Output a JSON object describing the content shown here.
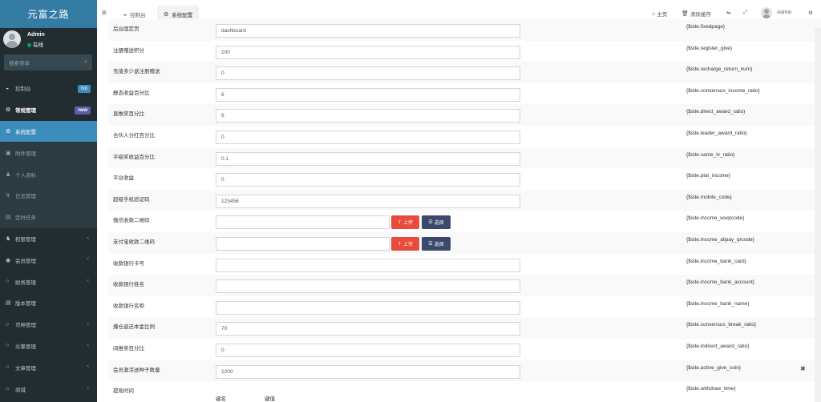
{
  "sidebar": {
    "brand": "元富之路",
    "user": {
      "name": "Admin",
      "status": "在线"
    },
    "search_placeholder": "搜索菜单",
    "items": [
      {
        "icon": "dashboard-icon",
        "glyph": "◒",
        "label": "控制台",
        "badge": "hot",
        "badge_color": "#3c8dbc",
        "style": "normal",
        "chevron": false
      },
      {
        "icon": "cogs-icon",
        "glyph": "⚙",
        "label": "常规管理",
        "badge": "new",
        "badge_color": "#605ca8",
        "style": "strong",
        "chevron": false
      },
      {
        "icon": "cog-icon",
        "glyph": "⚙",
        "label": "系统配置",
        "badge": "",
        "style": "active",
        "chevron": false
      },
      {
        "icon": "file-image-icon",
        "glyph": "▣",
        "label": "附件管理",
        "badge": "",
        "style": "sub",
        "chevron": false
      },
      {
        "icon": "user-icon",
        "glyph": "♟",
        "label": "个人资料",
        "badge": "",
        "style": "sub",
        "chevron": false
      },
      {
        "icon": "log-icon",
        "glyph": "↯",
        "label": "日志管理",
        "badge": "",
        "style": "sub",
        "chevron": false
      },
      {
        "icon": "tasks-icon",
        "glyph": "▤",
        "label": "定时任务",
        "badge": "",
        "style": "sub",
        "chevron": false
      },
      {
        "icon": "group-icon",
        "glyph": "♞",
        "label": "权限管理",
        "badge": "",
        "style": "normal",
        "chevron": true
      },
      {
        "icon": "user-circle-icon",
        "glyph": "◉",
        "label": "会员管理",
        "badge": "",
        "style": "normal",
        "chevron": true
      },
      {
        "icon": "circle-icon",
        "glyph": "○",
        "label": "财务管理",
        "badge": "",
        "style": "normal",
        "chevron": true
      },
      {
        "icon": "list-icon",
        "glyph": "▤",
        "label": "版本管理",
        "badge": "",
        "style": "normal",
        "chevron": false
      },
      {
        "icon": "circle-icon",
        "glyph": "○",
        "label": "币种管理",
        "badge": "",
        "style": "normal",
        "chevron": true
      },
      {
        "icon": "circle-icon",
        "glyph": "○",
        "label": "众筹管理",
        "badge": "",
        "style": "normal",
        "chevron": true
      },
      {
        "icon": "circle-icon",
        "glyph": "○",
        "label": "文章管理",
        "badge": "",
        "style": "normal",
        "chevron": true
      },
      {
        "icon": "home-icon",
        "glyph": "⌂",
        "label": "商城",
        "badge": "",
        "style": "normal",
        "chevron": true
      }
    ]
  },
  "header": {
    "tabs": [
      {
        "label": "控制台",
        "icon": "dashboard-icon",
        "glyph": "◒",
        "active": false
      },
      {
        "label": "系统配置",
        "icon": "cog-icon",
        "glyph": "⚙",
        "active": true
      }
    ],
    "right": {
      "home_label": "主页",
      "clear_cache_label": "清除缓存",
      "user_name": "Admin"
    }
  },
  "config_rows": [
    {
      "label": "后台固定页",
      "value": "dashboard",
      "key": "{$site.fixedpage}",
      "type": "text"
    },
    {
      "label": "注册赠送积分",
      "value": "100",
      "key": "{$site.register_give}",
      "type": "text"
    },
    {
      "label": "充值多少返注册赠送",
      "value": "0",
      "key": "{$site.recharge_return_num}",
      "type": "text"
    },
    {
      "label": "静态收益百分比",
      "value": "6",
      "key": "{$site.consensus_income_ratio}",
      "type": "text"
    },
    {
      "label": "直推奖百分比",
      "value": "6",
      "key": "{$site.direct_award_ratio}",
      "type": "text"
    },
    {
      "label": "合伙人分红百分比",
      "value": "0",
      "key": "{$site.leader_award_ratio}",
      "type": "text"
    },
    {
      "label": "平级奖收益百分比",
      "value": "0.1",
      "key": "{$site.same_lv_ratio}",
      "type": "text"
    },
    {
      "label": "平台收益",
      "value": "0",
      "key": "{$site.plat_income}",
      "type": "text"
    },
    {
      "label": "超级手机验证码",
      "value": "123456",
      "key": "{$site.mobile_code}",
      "type": "text"
    },
    {
      "label": "微信收款二维码",
      "value": "",
      "key": "{$site.income_wxqrcode}",
      "type": "upload"
    },
    {
      "label": "支付宝收款二维码",
      "value": "",
      "key": "{$site.income_alipay_qrcode}",
      "type": "upload"
    },
    {
      "label": "收款银行卡号",
      "value": "",
      "key": "{$site.income_bank_card}",
      "type": "text"
    },
    {
      "label": "收款银行姓名",
      "value": "",
      "key": "{$site.income_bank_account}",
      "type": "text"
    },
    {
      "label": "收款银行名称",
      "value": "",
      "key": "{$site.income_bank_name}",
      "type": "text"
    },
    {
      "label": "爆仓返还本金比例",
      "value": "70",
      "key": "{$site.consensus_break_ratio}",
      "type": "text"
    },
    {
      "label": "间推奖百分比",
      "value": "0",
      "key": "{$site.indirect_award_ratio}",
      "type": "text"
    },
    {
      "label": "会员激活送种子数量",
      "value": "1200",
      "key": "{$site.active_give_coin}",
      "type": "text",
      "closable": true
    },
    {
      "label": "提现时间",
      "value": "",
      "key": "{$site.withdraw_time}",
      "type": "kv",
      "kv_headers": [
        "键名",
        "键值"
      ]
    }
  ],
  "buttons": {
    "upload": "上传",
    "choose": "选择"
  },
  "close_glyph": "✖"
}
